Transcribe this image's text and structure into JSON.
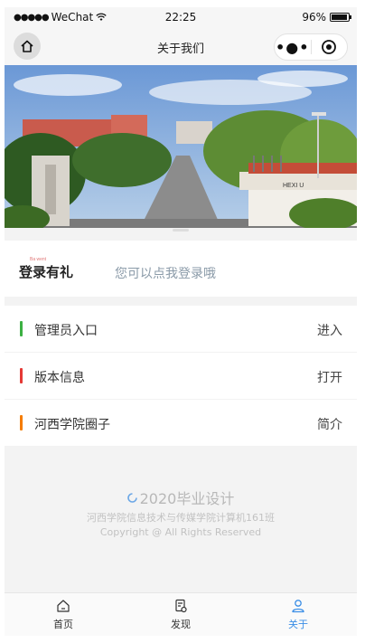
{
  "status_bar": {
    "carrier": "WeChat",
    "time": "22:25",
    "battery": "96%"
  },
  "nav": {
    "title": "关于我们"
  },
  "banner": {
    "image_desc": "campus-gate-photo",
    "gate_sign": "HEXI U"
  },
  "login": {
    "logo_text": "登录有礼",
    "prompt": "您可以点我登录哦"
  },
  "menu": {
    "items": [
      {
        "label": "管理员入口",
        "action": "进入",
        "color": "#3cb043"
      },
      {
        "label": "版本信息",
        "action": "打开",
        "color": "#e53935"
      },
      {
        "label": "河西学院圈子",
        "action": "简介",
        "color": "#f57c00"
      }
    ]
  },
  "footer": {
    "title": "2020毕业设计",
    "line1": "河西学院信息技术与传媒学院计算机161班",
    "line2": "Copyright @ All Rights Reserved"
  },
  "tabbar": {
    "tabs": [
      {
        "label": "首页",
        "icon": "home-icon",
        "active": false
      },
      {
        "label": "发现",
        "icon": "discover-icon",
        "active": false
      },
      {
        "label": "关于",
        "icon": "user-icon",
        "active": true
      }
    ]
  },
  "colors": {
    "accent": "#3a8ee6",
    "background": "#f3f3f3"
  }
}
